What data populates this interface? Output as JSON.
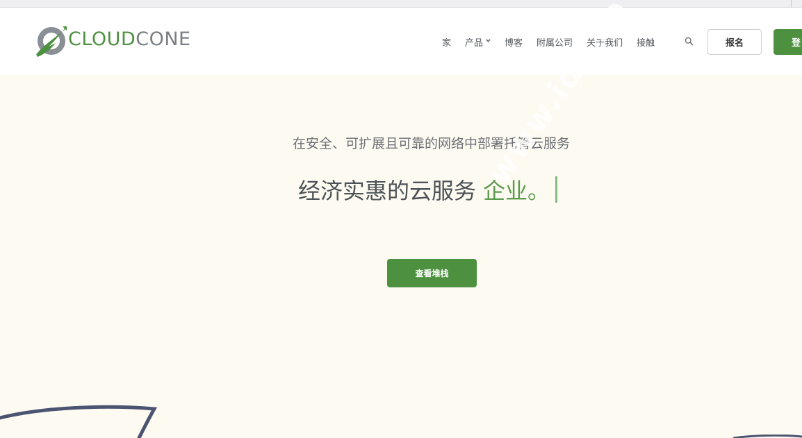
{
  "brand": {
    "logo_part1": "CLOUD",
    "logo_part2": "CONE",
    "logo_icon": "cloudcone-logo-icon",
    "colors": {
      "green": "#4d9140",
      "gray": "#7a7f86"
    }
  },
  "nav": {
    "items": [
      {
        "label": "家"
      },
      {
        "label": "产品",
        "has_dropdown": true
      },
      {
        "label": "博客"
      },
      {
        "label": "附属公司"
      },
      {
        "label": "关于我们"
      },
      {
        "label": "接触"
      }
    ],
    "search_icon": "search-icon",
    "signup_label": "报名",
    "login_label": "登"
  },
  "hero": {
    "subtitle": "在安全、可扩展且可靠的网络中部署托管云服务",
    "title": "经济实惠的云服务",
    "title_accent": "企业。",
    "cta_label": "查看堆栈"
  },
  "watermark": {
    "text": "www.idc.co"
  }
}
